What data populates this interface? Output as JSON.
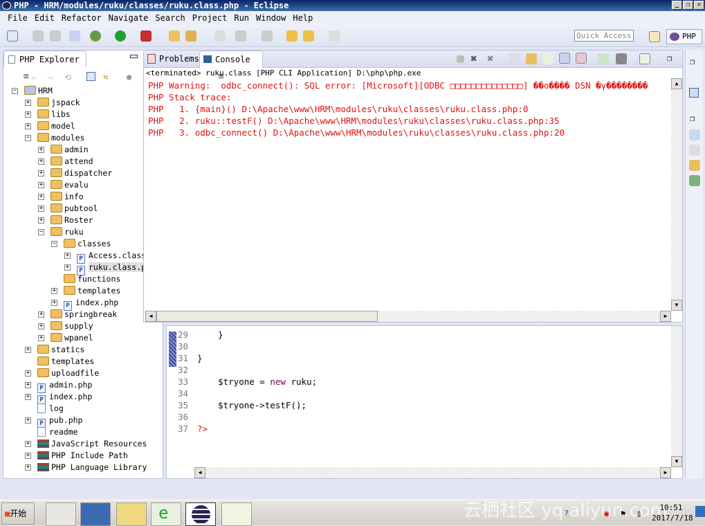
{
  "window": {
    "title": "PHP - HRM/modules/ruku/classes/ruku.class.php - Eclipse"
  },
  "menu": [
    "File",
    "Edit",
    "Refactor",
    "Navigate",
    "Search",
    "Project",
    "Run",
    "Window",
    "Help"
  ],
  "toolbar": {
    "quick_access_placeholder": "Quick Access",
    "perspective": "PHP"
  },
  "explorer": {
    "tab": "PHP Explorer",
    "tree": [
      {
        "label": "HRM",
        "depth": 0,
        "icon": "project",
        "exp": "-"
      },
      {
        "label": "jspack",
        "depth": 1,
        "icon": "folder",
        "exp": "+"
      },
      {
        "label": "libs",
        "depth": 1,
        "icon": "folder",
        "exp": "+"
      },
      {
        "label": "model",
        "depth": 1,
        "icon": "folder",
        "exp": "+"
      },
      {
        "label": "modules",
        "depth": 1,
        "icon": "folder",
        "exp": "-"
      },
      {
        "label": "admin",
        "depth": 2,
        "icon": "folder",
        "exp": "+"
      },
      {
        "label": "attend",
        "depth": 2,
        "icon": "folder",
        "exp": "+"
      },
      {
        "label": "dispatcher",
        "depth": 2,
        "icon": "folder",
        "exp": "+"
      },
      {
        "label": "evalu",
        "depth": 2,
        "icon": "folder",
        "exp": "+"
      },
      {
        "label": "info",
        "depth": 2,
        "icon": "folder",
        "exp": "+"
      },
      {
        "label": "pubtool",
        "depth": 2,
        "icon": "folder",
        "exp": "+"
      },
      {
        "label": "Roster",
        "depth": 2,
        "icon": "folder",
        "exp": "+"
      },
      {
        "label": "ruku",
        "depth": 2,
        "icon": "folder",
        "exp": "-"
      },
      {
        "label": "classes",
        "depth": 3,
        "icon": "folder",
        "exp": "-"
      },
      {
        "label": "Access.class.php",
        "depth": 4,
        "icon": "php",
        "exp": "+"
      },
      {
        "label": "ruku.class.php",
        "depth": 4,
        "icon": "php",
        "exp": "+",
        "selected": true
      },
      {
        "label": "functions",
        "depth": 3,
        "icon": "folder",
        "exp": ""
      },
      {
        "label": "templates",
        "depth": 3,
        "icon": "folder",
        "exp": "+"
      },
      {
        "label": "index.php",
        "depth": 3,
        "icon": "php",
        "exp": "+"
      },
      {
        "label": "springbreak",
        "depth": 2,
        "icon": "folder",
        "exp": "+"
      },
      {
        "label": "supply",
        "depth": 2,
        "icon": "folder",
        "exp": "+"
      },
      {
        "label": "wpanel",
        "depth": 2,
        "icon": "folder",
        "exp": "+"
      },
      {
        "label": "statics",
        "depth": 1,
        "icon": "folder",
        "exp": "+"
      },
      {
        "label": "templates",
        "depth": 1,
        "icon": "folder",
        "exp": ""
      },
      {
        "label": "uploadfile",
        "depth": 1,
        "icon": "folder",
        "exp": "+"
      },
      {
        "label": "admin.php",
        "depth": 1,
        "icon": "php",
        "exp": "+"
      },
      {
        "label": "index.php",
        "depth": 1,
        "icon": "php",
        "exp": "+"
      },
      {
        "label": "log",
        "depth": 1,
        "icon": "text",
        "exp": ""
      },
      {
        "label": "pub.php",
        "depth": 1,
        "icon": "php",
        "exp": "+"
      },
      {
        "label": "readme",
        "depth": 1,
        "icon": "text",
        "exp": ""
      },
      {
        "label": "JavaScript Resources",
        "depth": 1,
        "icon": "library",
        "exp": "+"
      },
      {
        "label": "PHP Include Path",
        "depth": 1,
        "icon": "library",
        "exp": "+"
      },
      {
        "label": "PHP Language Library",
        "depth": 1,
        "icon": "library",
        "exp": "+"
      }
    ]
  },
  "console": {
    "tabs": [
      "Problems",
      "Console"
    ],
    "status": "<terminated> ruku.class [PHP CLI Application] D:\\php\\php.exe",
    "lines": [
      "PHP Warning:  odbc_connect(): SQL error: [Microsoft][ODBC □□□□□□□□□□□□□□] ��ο���� DSN �γ��������",
      "PHP Stack trace:",
      "PHP   1. {main}() D:\\Apache\\www\\HRM\\modules\\ruku\\classes\\ruku.class.php:0",
      "PHP   2. ruku::testF() D:\\Apache\\www\\HRM\\modules\\ruku\\classes\\ruku.class.php:35",
      "PHP   3. odbc_connect() D:\\Apache\\www\\HRM\\modules\\ruku\\classes\\ruku.class.php:20"
    ],
    "color": "#e01010"
  },
  "editor": {
    "lines": [
      {
        "n": "29",
        "code": "    }"
      },
      {
        "n": "30",
        "code": ""
      },
      {
        "n": "31",
        "code": "}"
      },
      {
        "n": "32",
        "code": ""
      },
      {
        "n": "33",
        "pre": "    $tryone = ",
        "kw": "new",
        "post": " ruku;"
      },
      {
        "n": "34",
        "code": ""
      },
      {
        "n": "35",
        "code": "    $tryone->testF();"
      },
      {
        "n": "36",
        "code": ""
      },
      {
        "n": "37",
        "tag": "?>"
      }
    ]
  },
  "taskbar": {
    "start": "开始",
    "time": "10:51",
    "date": "2017/7/18",
    "watermark": "云栖社区 yq.aliyun.com"
  }
}
